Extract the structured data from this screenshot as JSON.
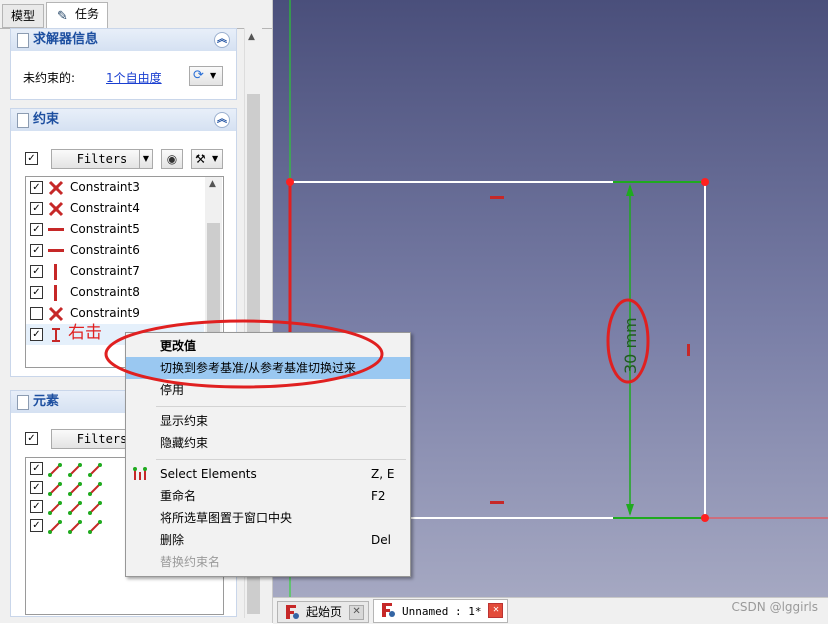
{
  "tabs": [
    "模型",
    "任务"
  ],
  "solver_panel": {
    "title": "求解器信息",
    "unconstrained_label": "未约束的:",
    "dof_link": "1个自由度"
  },
  "constraints_panel": {
    "title": "约束",
    "filter_label": "Filters",
    "items": [
      {
        "label": "Constraint3",
        "checked": true,
        "icon": "coincident-icon"
      },
      {
        "label": "Constraint4",
        "checked": true,
        "icon": "coincident-icon"
      },
      {
        "label": "Constraint5",
        "checked": true,
        "icon": "horizontal-icon"
      },
      {
        "label": "Constraint6",
        "checked": true,
        "icon": "horizontal-icon"
      },
      {
        "label": "Constraint7",
        "checked": true,
        "icon": "vertical-icon"
      },
      {
        "label": "Constraint8",
        "checked": true,
        "icon": "vertical-icon"
      },
      {
        "label": "Constraint9",
        "checked": false,
        "icon": "coincident-icon"
      },
      {
        "label": "",
        "checked": true,
        "icon": "vertical-distance-icon"
      }
    ]
  },
  "annotation_text": "右击",
  "elements_panel": {
    "title": "元素",
    "filter_label": "Filters"
  },
  "context_menu": [
    {
      "label": "更改值",
      "shortcut": "",
      "bold": true
    },
    {
      "label": "切换到参考基准/从参考基准切换过来",
      "shortcut": "",
      "highlight": true
    },
    {
      "label": "停用",
      "shortcut": ""
    },
    {
      "sep": true
    },
    {
      "label": "显示约束",
      "shortcut": ""
    },
    {
      "label": "隐藏约束",
      "shortcut": ""
    },
    {
      "sep": true
    },
    {
      "label": "Select Elements",
      "shortcut": "Z, E",
      "icon": "select-elements-icon"
    },
    {
      "label": "重命名",
      "shortcut": "F2"
    },
    {
      "label": "将所选草图置于窗口中央",
      "shortcut": ""
    },
    {
      "label": "删除",
      "shortcut": "Del"
    },
    {
      "label": "替换约束名",
      "shortcut": "",
      "disabled": true
    }
  ],
  "sketch": {
    "dimension_value": "30 mm"
  },
  "bottom_tabs": [
    {
      "label": "起始页"
    },
    {
      "label": "Unnamed : 1*"
    }
  ],
  "watermark": "CSDN @lggirls",
  "colors": {
    "accent": "#1d4fa0",
    "highlight": "#9ac8f1",
    "annotation": "#e02020",
    "constraint_red": "#c62828",
    "dimension_green": "#1faa1f"
  }
}
